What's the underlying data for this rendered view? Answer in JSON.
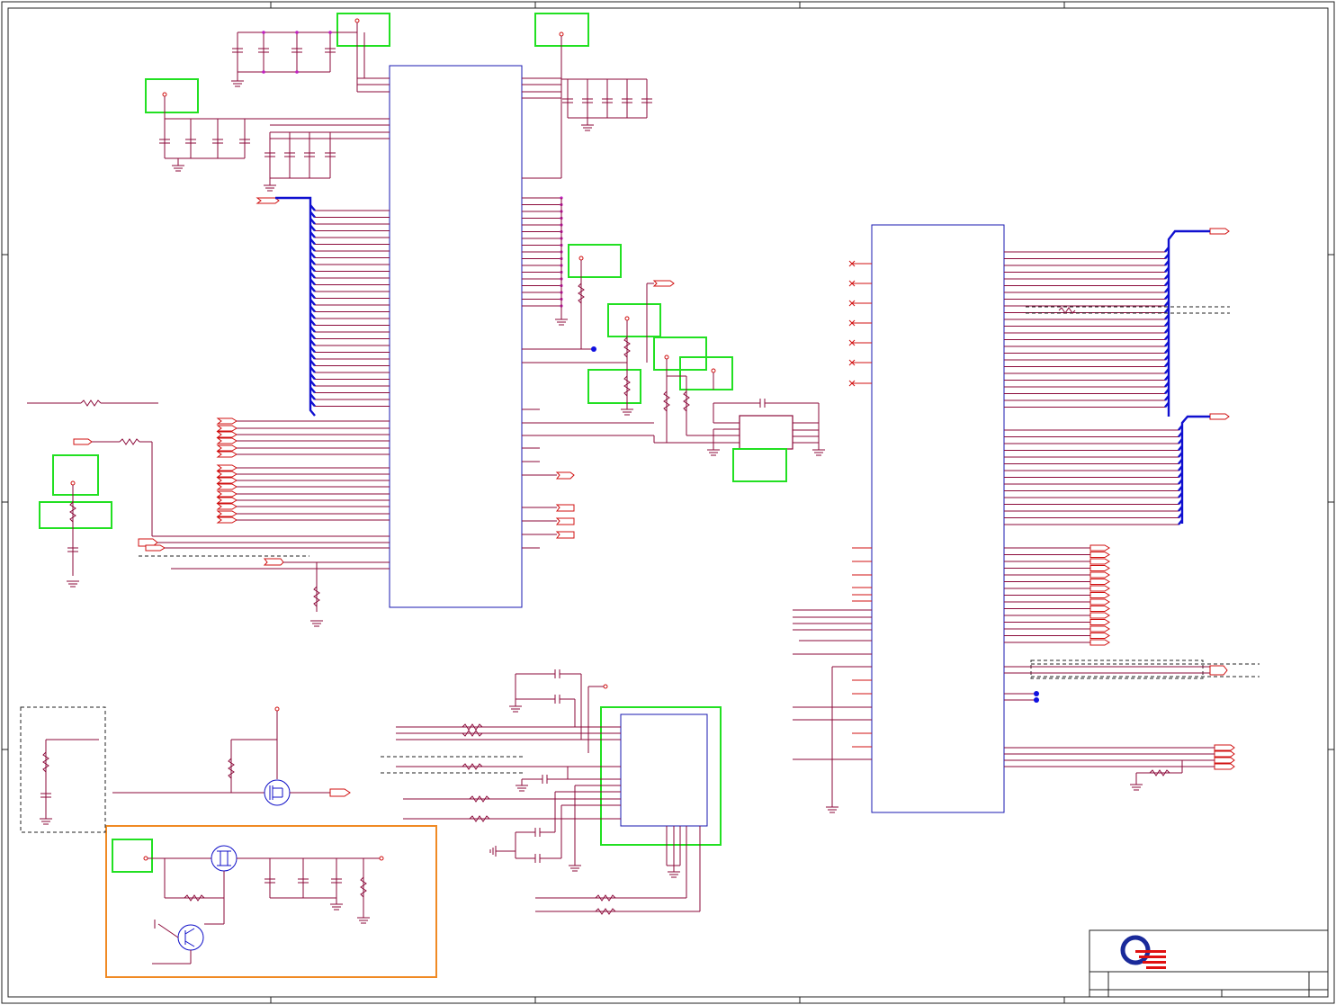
{
  "sheet": {
    "title_block_text": [],
    "zones": {
      "columns": [],
      "rows": []
    }
  },
  "icons": {
    "logo": "company-logo-icon",
    "ground": "ground-icon",
    "mosfet": "mosfet-icon",
    "transistor": "transistor-icon"
  },
  "colors": {
    "wire": "#8b0a3a",
    "net_flag": "#d01010",
    "bus": "#1010d0",
    "ic_outline": "#1a1ab0",
    "highlight_green": "#22e022",
    "highlight_orange": "#f08a24",
    "junction": "#c020c0"
  }
}
